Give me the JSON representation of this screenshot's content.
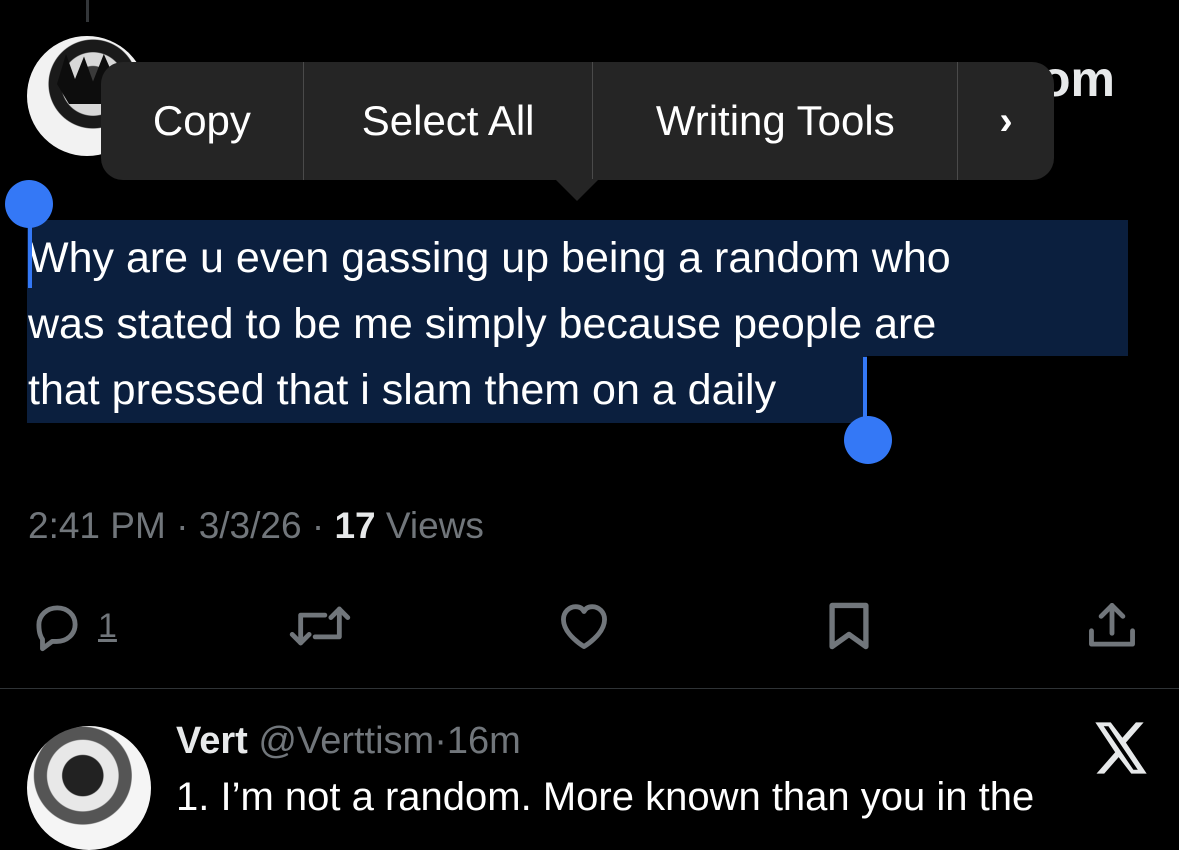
{
  "context_menu": {
    "copy": "Copy",
    "select_all": "Select All",
    "writing_tools": "Writing Tools",
    "more": "›"
  },
  "header_peek": "om",
  "tweet": {
    "text_line1": "Why are u even gassing up being a random who",
    "text_line2": "was stated to be me simply because people are",
    "text_line3": "that pressed that i slam them on a daily",
    "time": "2:41 PM",
    "date": "3/3/26",
    "sep": "·",
    "views_count": "17",
    "views_label": "Views",
    "reply_count": "1"
  },
  "icons": {
    "reply": "reply-icon",
    "repost": "repost-icon",
    "like": "like-icon",
    "bookmark": "bookmark-icon",
    "share": "share-icon",
    "x_logo": "x-logo-icon"
  },
  "reply": {
    "name": "Vert",
    "handle": "@Verttism",
    "dot": "·",
    "time": "16m",
    "text": "1. I’m not a random. More known than you in the"
  },
  "colors": {
    "background": "#000000",
    "selection": "#0b1f3e",
    "handle": "#3478f6",
    "muted": "#71767b",
    "menu": "#252525"
  }
}
